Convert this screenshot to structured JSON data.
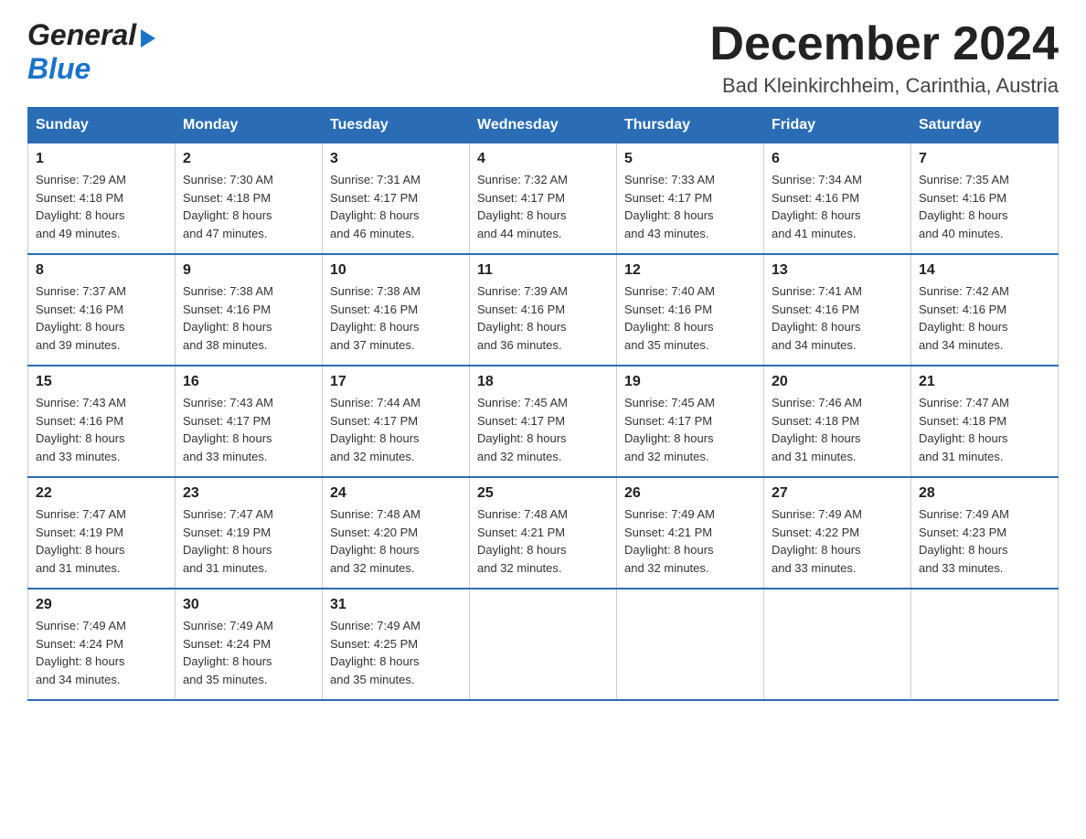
{
  "header": {
    "logo_general": "General",
    "logo_blue": "Blue",
    "month_title": "December 2024",
    "location": "Bad Kleinkirchheim, Carinthia, Austria"
  },
  "days_of_week": [
    "Sunday",
    "Monday",
    "Tuesday",
    "Wednesday",
    "Thursday",
    "Friday",
    "Saturday"
  ],
  "weeks": [
    [
      {
        "day": "1",
        "sunrise": "Sunrise: 7:29 AM",
        "sunset": "Sunset: 4:18 PM",
        "daylight": "Daylight: 8 hours",
        "daylight2": "and 49 minutes."
      },
      {
        "day": "2",
        "sunrise": "Sunrise: 7:30 AM",
        "sunset": "Sunset: 4:18 PM",
        "daylight": "Daylight: 8 hours",
        "daylight2": "and 47 minutes."
      },
      {
        "day": "3",
        "sunrise": "Sunrise: 7:31 AM",
        "sunset": "Sunset: 4:17 PM",
        "daylight": "Daylight: 8 hours",
        "daylight2": "and 46 minutes."
      },
      {
        "day": "4",
        "sunrise": "Sunrise: 7:32 AM",
        "sunset": "Sunset: 4:17 PM",
        "daylight": "Daylight: 8 hours",
        "daylight2": "and 44 minutes."
      },
      {
        "day": "5",
        "sunrise": "Sunrise: 7:33 AM",
        "sunset": "Sunset: 4:17 PM",
        "daylight": "Daylight: 8 hours",
        "daylight2": "and 43 minutes."
      },
      {
        "day": "6",
        "sunrise": "Sunrise: 7:34 AM",
        "sunset": "Sunset: 4:16 PM",
        "daylight": "Daylight: 8 hours",
        "daylight2": "and 41 minutes."
      },
      {
        "day": "7",
        "sunrise": "Sunrise: 7:35 AM",
        "sunset": "Sunset: 4:16 PM",
        "daylight": "Daylight: 8 hours",
        "daylight2": "and 40 minutes."
      }
    ],
    [
      {
        "day": "8",
        "sunrise": "Sunrise: 7:37 AM",
        "sunset": "Sunset: 4:16 PM",
        "daylight": "Daylight: 8 hours",
        "daylight2": "and 39 minutes."
      },
      {
        "day": "9",
        "sunrise": "Sunrise: 7:38 AM",
        "sunset": "Sunset: 4:16 PM",
        "daylight": "Daylight: 8 hours",
        "daylight2": "and 38 minutes."
      },
      {
        "day": "10",
        "sunrise": "Sunrise: 7:38 AM",
        "sunset": "Sunset: 4:16 PM",
        "daylight": "Daylight: 8 hours",
        "daylight2": "and 37 minutes."
      },
      {
        "day": "11",
        "sunrise": "Sunrise: 7:39 AM",
        "sunset": "Sunset: 4:16 PM",
        "daylight": "Daylight: 8 hours",
        "daylight2": "and 36 minutes."
      },
      {
        "day": "12",
        "sunrise": "Sunrise: 7:40 AM",
        "sunset": "Sunset: 4:16 PM",
        "daylight": "Daylight: 8 hours",
        "daylight2": "and 35 minutes."
      },
      {
        "day": "13",
        "sunrise": "Sunrise: 7:41 AM",
        "sunset": "Sunset: 4:16 PM",
        "daylight": "Daylight: 8 hours",
        "daylight2": "and 34 minutes."
      },
      {
        "day": "14",
        "sunrise": "Sunrise: 7:42 AM",
        "sunset": "Sunset: 4:16 PM",
        "daylight": "Daylight: 8 hours",
        "daylight2": "and 34 minutes."
      }
    ],
    [
      {
        "day": "15",
        "sunrise": "Sunrise: 7:43 AM",
        "sunset": "Sunset: 4:16 PM",
        "daylight": "Daylight: 8 hours",
        "daylight2": "and 33 minutes."
      },
      {
        "day": "16",
        "sunrise": "Sunrise: 7:43 AM",
        "sunset": "Sunset: 4:17 PM",
        "daylight": "Daylight: 8 hours",
        "daylight2": "and 33 minutes."
      },
      {
        "day": "17",
        "sunrise": "Sunrise: 7:44 AM",
        "sunset": "Sunset: 4:17 PM",
        "daylight": "Daylight: 8 hours",
        "daylight2": "and 32 minutes."
      },
      {
        "day": "18",
        "sunrise": "Sunrise: 7:45 AM",
        "sunset": "Sunset: 4:17 PM",
        "daylight": "Daylight: 8 hours",
        "daylight2": "and 32 minutes."
      },
      {
        "day": "19",
        "sunrise": "Sunrise: 7:45 AM",
        "sunset": "Sunset: 4:17 PM",
        "daylight": "Daylight: 8 hours",
        "daylight2": "and 32 minutes."
      },
      {
        "day": "20",
        "sunrise": "Sunrise: 7:46 AM",
        "sunset": "Sunset: 4:18 PM",
        "daylight": "Daylight: 8 hours",
        "daylight2": "and 31 minutes."
      },
      {
        "day": "21",
        "sunrise": "Sunrise: 7:47 AM",
        "sunset": "Sunset: 4:18 PM",
        "daylight": "Daylight: 8 hours",
        "daylight2": "and 31 minutes."
      }
    ],
    [
      {
        "day": "22",
        "sunrise": "Sunrise: 7:47 AM",
        "sunset": "Sunset: 4:19 PM",
        "daylight": "Daylight: 8 hours",
        "daylight2": "and 31 minutes."
      },
      {
        "day": "23",
        "sunrise": "Sunrise: 7:47 AM",
        "sunset": "Sunset: 4:19 PM",
        "daylight": "Daylight: 8 hours",
        "daylight2": "and 31 minutes."
      },
      {
        "day": "24",
        "sunrise": "Sunrise: 7:48 AM",
        "sunset": "Sunset: 4:20 PM",
        "daylight": "Daylight: 8 hours",
        "daylight2": "and 32 minutes."
      },
      {
        "day": "25",
        "sunrise": "Sunrise: 7:48 AM",
        "sunset": "Sunset: 4:21 PM",
        "daylight": "Daylight: 8 hours",
        "daylight2": "and 32 minutes."
      },
      {
        "day": "26",
        "sunrise": "Sunrise: 7:49 AM",
        "sunset": "Sunset: 4:21 PM",
        "daylight": "Daylight: 8 hours",
        "daylight2": "and 32 minutes."
      },
      {
        "day": "27",
        "sunrise": "Sunrise: 7:49 AM",
        "sunset": "Sunset: 4:22 PM",
        "daylight": "Daylight: 8 hours",
        "daylight2": "and 33 minutes."
      },
      {
        "day": "28",
        "sunrise": "Sunrise: 7:49 AM",
        "sunset": "Sunset: 4:23 PM",
        "daylight": "Daylight: 8 hours",
        "daylight2": "and 33 minutes."
      }
    ],
    [
      {
        "day": "29",
        "sunrise": "Sunrise: 7:49 AM",
        "sunset": "Sunset: 4:24 PM",
        "daylight": "Daylight: 8 hours",
        "daylight2": "and 34 minutes."
      },
      {
        "day": "30",
        "sunrise": "Sunrise: 7:49 AM",
        "sunset": "Sunset: 4:24 PM",
        "daylight": "Daylight: 8 hours",
        "daylight2": "and 35 minutes."
      },
      {
        "day": "31",
        "sunrise": "Sunrise: 7:49 AM",
        "sunset": "Sunset: 4:25 PM",
        "daylight": "Daylight: 8 hours",
        "daylight2": "and 35 minutes."
      },
      null,
      null,
      null,
      null
    ]
  ]
}
